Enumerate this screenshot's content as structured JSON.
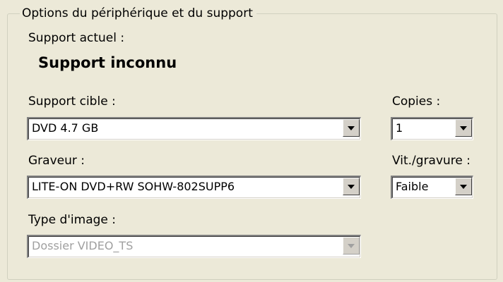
{
  "group": {
    "title": "Options du périphérique et du support"
  },
  "current_media": {
    "label": "Support actuel :",
    "value": "Support inconnu"
  },
  "target_media": {
    "label": "Support cible :",
    "selected": "DVD 4.7 GB"
  },
  "copies": {
    "label": "Copies :",
    "selected": "1"
  },
  "burner": {
    "label": "Graveur :",
    "selected": "LITE-ON DVD+RW SOHW-802SUPP6"
  },
  "burn_speed": {
    "label": "Vit./gravure :",
    "selected": "Faible"
  },
  "image_type": {
    "label": "Type d'image :",
    "selected": "Dossier VIDEO_TS",
    "disabled": true
  }
}
